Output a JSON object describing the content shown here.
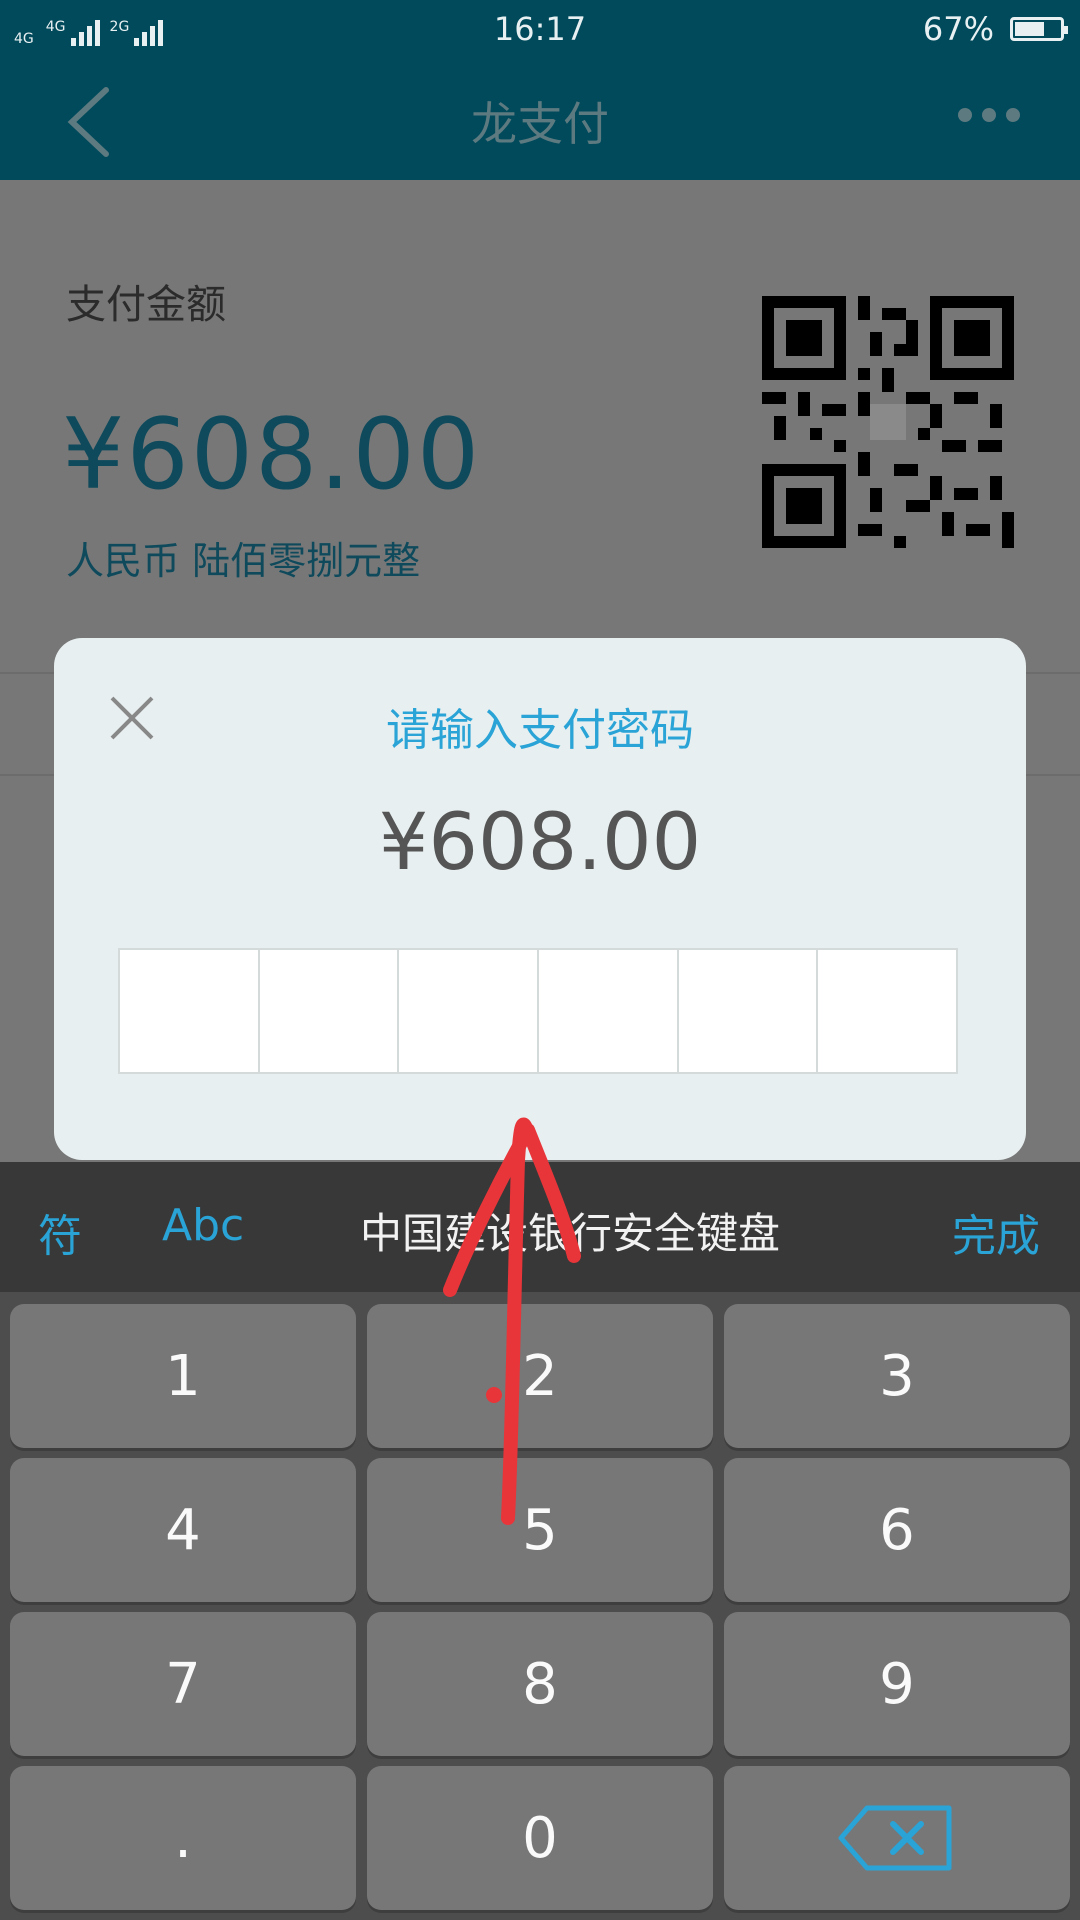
{
  "status_bar": {
    "net1": "4G",
    "net2": "4G",
    "net3": "2G",
    "time": "16:17",
    "battery_text": "67%",
    "battery_level": 0.67
  },
  "nav": {
    "title": "龙支付"
  },
  "payment": {
    "label": "支付金额",
    "amount": "¥608.00",
    "amount_words": "人民币 陆佰零捌元整"
  },
  "dialog": {
    "title": "请输入支付密码",
    "amount": "¥608.00",
    "password_length": 6
  },
  "keyboard": {
    "symbols_label": "符",
    "abc_label": "Abc",
    "name": "中国建设银行安全键盘",
    "done_label": "完成",
    "keys": [
      "1",
      "2",
      "3",
      "4",
      "5",
      "6",
      "7",
      "8",
      "9",
      ".",
      "0"
    ]
  },
  "colors": {
    "header": "#004a5b",
    "accent": "#2aa3d6",
    "annotation": "#e8353a"
  },
  "icons": {
    "back": "chevron-left-icon",
    "more": "more-dots-icon",
    "close": "close-icon",
    "backspace": "backspace-icon",
    "annotation": "red-arrow-icon"
  }
}
